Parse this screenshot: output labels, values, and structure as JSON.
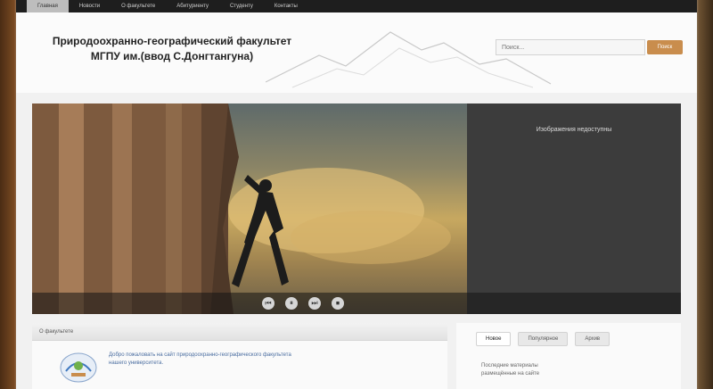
{
  "topnav": {
    "items": [
      "Главная",
      "Новости",
      "О факультете",
      "Абитуриенту",
      "Студенту",
      "Контакты"
    ]
  },
  "header": {
    "title_line1": "Природоохранно-географический факультет",
    "title_line2": "МГПУ им.(ввод С.Донгтангуна)"
  },
  "search": {
    "placeholder": "Поиск...",
    "button_label": "Поиск"
  },
  "slider": {
    "caption": "Изображения недоступны",
    "controls": [
      "⏮",
      "⏸",
      "⏭",
      "⏹"
    ]
  },
  "content": {
    "header_label": "О факультете",
    "text_line1": "Добро пожаловать на сайт природоохранно-географического факультета",
    "text_line2": "нашего университета."
  },
  "sidebar": {
    "tabs": [
      "Новое",
      "Популярное",
      "Архив"
    ],
    "text_line1": "Последние материалы",
    "text_line2": "размещённые на сайте"
  },
  "colors": {
    "search_button": "#c98d4d",
    "topnav_bg": "#1e1e1e",
    "caption_panel": "#3c3c3c"
  }
}
